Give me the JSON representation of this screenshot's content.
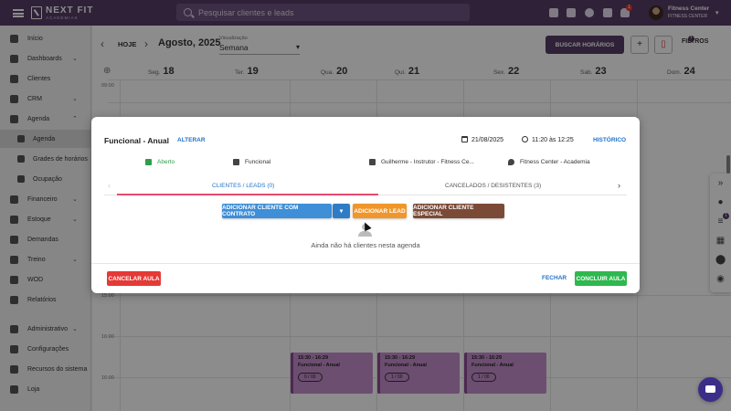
{
  "topbar": {
    "brand": "NEXT FIT",
    "brand_sub": "ACADEMIAS",
    "search_placeholder": "Pesquisar clientes e leads",
    "notification_count": "1",
    "user_name": "Fitness Center",
    "user_sub": "FITNESS CENTER"
  },
  "sidebar": {
    "items": [
      {
        "label": "Início",
        "icon": "home-icon"
      },
      {
        "label": "Dashboards",
        "icon": "dashboard-icon",
        "chev": "⌄"
      },
      {
        "label": "Clientes",
        "icon": "users-icon"
      },
      {
        "label": "CRM",
        "icon": "crm-icon",
        "chev": "⌄"
      },
      {
        "label": "Agenda",
        "icon": "calendar-icon",
        "chev": "⌃"
      },
      {
        "label": "Agenda",
        "icon": "calendar-icon",
        "sub": true,
        "active": true
      },
      {
        "label": "Grades de horários",
        "icon": "grid-icon",
        "sub": true
      },
      {
        "label": "Ocupação",
        "icon": "occupation-icon",
        "sub": true
      },
      {
        "label": "Financeiro",
        "icon": "money-icon",
        "chev": "⌄"
      },
      {
        "label": "Estoque",
        "icon": "cart-icon",
        "chev": "⌄"
      },
      {
        "label": "Demandas",
        "icon": "demands-icon"
      },
      {
        "label": "Treino",
        "icon": "dumbbell-icon",
        "chev": "⌄"
      },
      {
        "label": "WOD",
        "icon": "wod-icon"
      },
      {
        "label": "Relatórios",
        "icon": "reports-icon"
      },
      {
        "label": "Administrativo",
        "icon": "admin-icon",
        "chev": "⌄"
      },
      {
        "label": "Configurações",
        "icon": "gear-icon"
      },
      {
        "label": "Recursos do sistema",
        "icon": "toggle-icon"
      },
      {
        "label": "Loja",
        "icon": "store-icon"
      }
    ]
  },
  "calendar": {
    "today_label": "HOJE",
    "month": "Agosto, 2025",
    "view_label": "Visualização",
    "view_value": "Semana",
    "search_schedules": "BUSCAR HORÁRIOS",
    "filters": "FILTROS",
    "filters_badge": "1",
    "days": [
      {
        "dow": "Seg.",
        "num": "18"
      },
      {
        "dow": "Ter.",
        "num": "19"
      },
      {
        "dow": "Qua.",
        "num": "20"
      },
      {
        "dow": "Qui.",
        "num": "21"
      },
      {
        "dow": "Sex.",
        "num": "22"
      },
      {
        "dow": "Sab.",
        "num": "23"
      },
      {
        "dow": "Dom.",
        "num": "24"
      }
    ],
    "hours": [
      "09:00",
      "15:00",
      "16:00",
      "16:00"
    ],
    "events": [
      {
        "time": "15:30 - 16:29",
        "name": "Funcional - Anual",
        "count": "0 / 00"
      },
      {
        "time": "15:30 - 16:29",
        "name": "Funcional - Anual",
        "count": "1 / 00"
      },
      {
        "time": "15:30 - 16:29",
        "name": "Funcional - Anual",
        "count": "1 / 00"
      }
    ]
  },
  "modal": {
    "title": "Funcional - Anual",
    "alter": "ALTERAR",
    "date": "21/08/2025",
    "time": "11:20 às 12:25",
    "history": "HISTÓRICO",
    "status": "Aberto",
    "modality": "Funcional",
    "instructor": "Guilherme - Instrutor - Fitness Ce...",
    "location": "Fitness Center - Academia",
    "tab_clients": "CLIENTES / LEADS (0)",
    "tab_cancelled": "CANCELADOS / DESISTENTES (3)",
    "btn_add_contract": "ADICIONAR CLIENTE COM CONTRATO",
    "btn_add_lead": "ADICIONAR LEAD",
    "btn_add_special": "ADICIONAR CLIENTE ESPECIAL",
    "empty_text": "Ainda não há clientes nesta agenda",
    "btn_cancel": "CANCELAR AULA",
    "btn_close": "FECHAR",
    "btn_conclude": "CONCLUIR AULA"
  },
  "rightbar": {
    "badge": "1"
  },
  "colors": {
    "brand": "#563c66",
    "accent_blue": "#3e8ed8",
    "lead_orange": "#f0962a",
    "special_brown": "#7b4a37",
    "danger": "#e53935",
    "success": "#2eb84e",
    "event": "#c58fcc"
  }
}
